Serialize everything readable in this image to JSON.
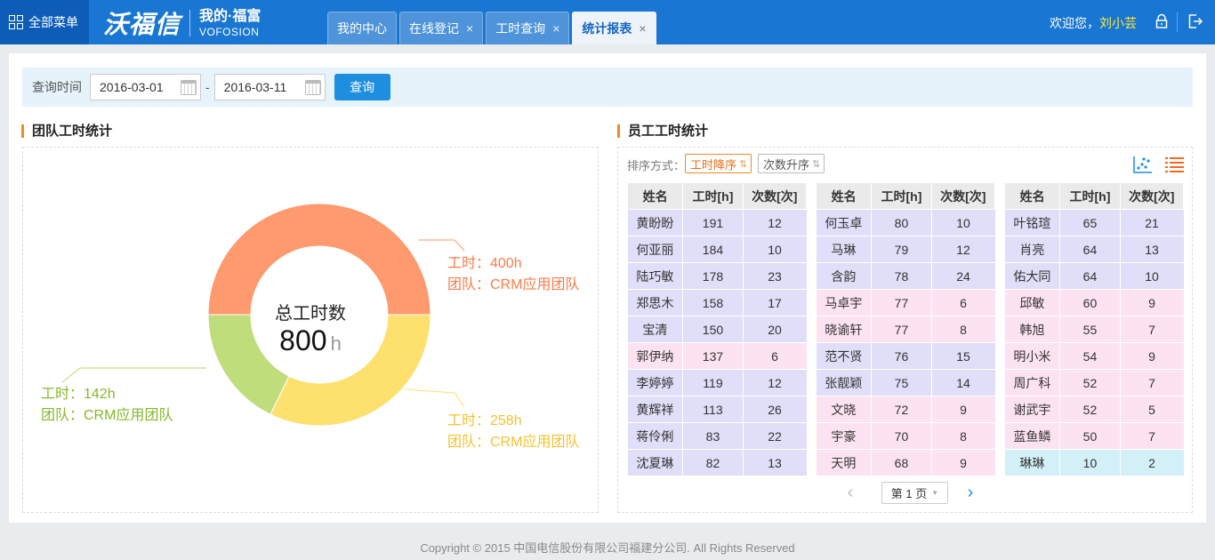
{
  "header": {
    "menu_label": "全部菜单",
    "brand": "沃福信",
    "tagline": "我的·福富",
    "tagline_en": "VOFOSION",
    "tabs": [
      {
        "label": "我的中心",
        "closable": false
      },
      {
        "label": "在线登记",
        "closable": true
      },
      {
        "label": "工时查询",
        "closable": true
      },
      {
        "label": "统计报表",
        "closable": true,
        "active": true
      }
    ],
    "close_glyph": "×",
    "welcome": "欢迎您，",
    "username": "刘小芸",
    "icons": [
      "lock-icon",
      "logout-icon"
    ]
  },
  "query": {
    "label": "查询时间",
    "start_date": "2016-03-01",
    "separator": "-",
    "end_date": "2016-03-11",
    "button": "查询"
  },
  "team_section": {
    "title": "团队工时统计",
    "center_title": "总工时数",
    "center_value": "800",
    "center_unit": "h",
    "segments": [
      {
        "hours_label": "工时：400h",
        "team_label": "团队：CRM应用团队",
        "hours": 400,
        "color": "#ff9a6e"
      },
      {
        "hours_label": "工时：258h",
        "team_label": "团队：CRM应用团队",
        "hours": 258,
        "color": "#fee06f"
      },
      {
        "hours_label": "工时：142h",
        "team_label": "团队：CRM应用团队",
        "hours": 142,
        "color": "#c0dd7b"
      }
    ]
  },
  "employee_section": {
    "title": "员工工时统计",
    "sort_label": "排序方式：",
    "sort_options": [
      {
        "label": "工时降序",
        "active": true
      },
      {
        "label": "次数升序",
        "active": false
      }
    ],
    "sort_arrows": "⇅",
    "view_icons": [
      "scatter-chart-icon",
      "list-view-icon"
    ],
    "columns": [
      "姓名",
      "工时[h]",
      "次数[次]"
    ],
    "tables": [
      [
        {
          "name": "黄盼盼",
          "hours": "191",
          "count": "12",
          "tone": "b"
        },
        {
          "name": "何亚丽",
          "hours": "184",
          "count": "10",
          "tone": "b"
        },
        {
          "name": "陆巧敏",
          "hours": "178",
          "count": "23",
          "tone": "b"
        },
        {
          "name": "郑思木",
          "hours": "158",
          "count": "17",
          "tone": "b"
        },
        {
          "name": "宝清",
          "hours": "150",
          "count": "20",
          "tone": "b"
        },
        {
          "name": "郭伊纳",
          "hours": "137",
          "count": "6",
          "tone": "p"
        },
        {
          "name": "李婷婷",
          "hours": "119",
          "count": "12",
          "tone": "b"
        },
        {
          "name": "黄辉祥",
          "hours": "113",
          "count": "26",
          "tone": "b"
        },
        {
          "name": "蒋伶俐",
          "hours": "83",
          "count": "22",
          "tone": "b"
        },
        {
          "name": "沈夏琳",
          "hours": "82",
          "count": "13",
          "tone": "b"
        }
      ],
      [
        {
          "name": "何玉卓",
          "hours": "80",
          "count": "10",
          "tone": "b"
        },
        {
          "name": "马琳",
          "hours": "79",
          "count": "12",
          "tone": "b"
        },
        {
          "name": "含韵",
          "hours": "78",
          "count": "24",
          "tone": "b"
        },
        {
          "name": "马卓宇",
          "hours": "77",
          "count": "6",
          "tone": "p"
        },
        {
          "name": "晓谕轩",
          "hours": "77",
          "count": "8",
          "tone": "p"
        },
        {
          "name": "范不贤",
          "hours": "76",
          "count": "15",
          "tone": "b"
        },
        {
          "name": "张靓颖",
          "hours": "75",
          "count": "14",
          "tone": "b"
        },
        {
          "name": "文晓",
          "hours": "72",
          "count": "9",
          "tone": "p"
        },
        {
          "name": "宇豪",
          "hours": "70",
          "count": "8",
          "tone": "p"
        },
        {
          "name": "天明",
          "hours": "68",
          "count": "9",
          "tone": "p"
        }
      ],
      [
        {
          "name": "叶铭瑄",
          "hours": "65",
          "count": "21",
          "tone": "b"
        },
        {
          "name": "肖亮",
          "hours": "64",
          "count": "13",
          "tone": "b"
        },
        {
          "name": "佑大同",
          "hours": "64",
          "count": "10",
          "tone": "b"
        },
        {
          "name": "邱敏",
          "hours": "60",
          "count": "9",
          "tone": "p"
        },
        {
          "name": "韩旭",
          "hours": "55",
          "count": "7",
          "tone": "p"
        },
        {
          "name": "明小米",
          "hours": "54",
          "count": "9",
          "tone": "p"
        },
        {
          "name": "周广科",
          "hours": "52",
          "count": "7",
          "tone": "p"
        },
        {
          "name": "谢武宇",
          "hours": "52",
          "count": "5",
          "tone": "p"
        },
        {
          "name": "蓝鱼鳞",
          "hours": "50",
          "count": "7",
          "tone": "p"
        },
        {
          "name": "琳琳",
          "hours": "10",
          "count": "2",
          "tone": "c"
        }
      ]
    ],
    "pager": {
      "prev": "‹",
      "page_label": "第 1 页",
      "caret": "▼",
      "next": "›"
    }
  },
  "footer": "Copyright © 2015 中国电信股份有限公司福建分公司. All Rights Reserved"
}
